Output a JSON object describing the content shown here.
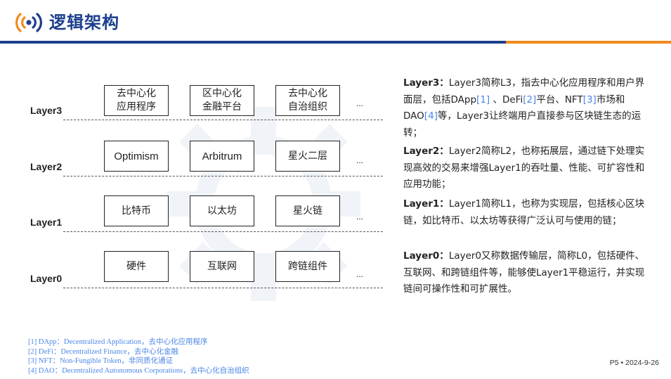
{
  "header": {
    "title": "逻辑架构",
    "icon": "broadcast-signal-icon",
    "brand_color": "#1c3f8c",
    "accent_color": "#f08b1c"
  },
  "layers": [
    {
      "label": "Layer3",
      "items": [
        "去中心化\n应用程序",
        "区中心化\n金融平台",
        "去中心化\n自治组织"
      ],
      "more": "..."
    },
    {
      "label": "Layer2",
      "items": [
        "Optimism",
        "Arbitrum",
        "星火二层"
      ],
      "more": "..."
    },
    {
      "label": "Layer1",
      "items": [
        "比特币",
        "以太坊",
        "星火链"
      ],
      "more": "..."
    },
    {
      "label": "Layer0",
      "items": [
        "硬件",
        "互联网",
        "跨链组件"
      ],
      "more": "..."
    }
  ],
  "descriptions": [
    {
      "key": "Layer3：",
      "parts": [
        {
          "t": "Layer3简称L3，指去中心化应用程序和用户界面层，包括DApp"
        },
        {
          "t": "[1]",
          "ref": true
        },
        {
          "t": " 、DeFi"
        },
        {
          "t": "[2]",
          "ref": true
        },
        {
          "t": "平台、NFT"
        },
        {
          "t": "[3]",
          "ref": true
        },
        {
          "t": "市场和DAO"
        },
        {
          "t": "[4]",
          "ref": true
        },
        {
          "t": "等，Layer3让终端用户直接参与区块链生态的运转；"
        }
      ]
    },
    {
      "key": "Layer2：",
      "parts": [
        {
          "t": "Layer2简称L2，也称拓展层，通过链下处理实现高效的交易来增强Layer1的吞吐量、性能、可扩容性和应用功能；"
        }
      ]
    },
    {
      "key": "Layer1：",
      "parts": [
        {
          "t": "Layer1简称L1，也称为实现层，包括核心区块链，如比特币、以太坊等获得广泛认可与使用的链；"
        }
      ]
    },
    {
      "key": "Layer0：",
      "parts": [
        {
          "t": "Layer0又称数据传输层，简称L0，包括硬件、互联网、和跨链组件等，能够使Layer1平稳运行，并实现链间可操作性和可扩展性。"
        }
      ]
    }
  ],
  "footnotes": [
    "[1] DApp：Decentralized Application，去中心化应用程序",
    "[2] DeFi：Decentralized  Finance，去中心化金融",
    "[3] NFT：Non-Fungible Token，非同质化通证",
    "[4] DAO：Decentralized Autonomous Corporations，去中心化自治组织"
  ],
  "footer": {
    "page": "P5",
    "date": "2024-9-26"
  }
}
